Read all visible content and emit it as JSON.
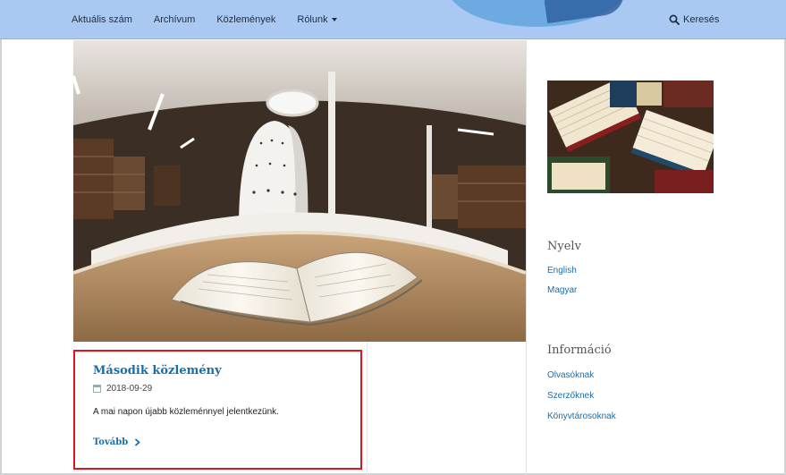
{
  "nav": {
    "items": [
      "Aktuális szám",
      "Archívum",
      "Közlemények",
      "Rólunk"
    ],
    "search_label": "Keresés"
  },
  "news": {
    "title": "Második közlemény",
    "date": "2018-09-29",
    "summary": "A mai napon újabb közleménnyel jelentkezünk.",
    "more_label": "Tovább"
  },
  "sidebar": {
    "language": {
      "heading": "Nyelv",
      "links": [
        "English",
        "Magyar"
      ]
    },
    "info": {
      "heading": "Információ",
      "links": [
        "Olvasóknak",
        "Szerzőknek",
        "Könyvtárosoknak"
      ]
    }
  },
  "colors": {
    "nav_bg": "#a9c9f2",
    "link": "#1a6da8",
    "highlight_box": "#e0141e"
  }
}
